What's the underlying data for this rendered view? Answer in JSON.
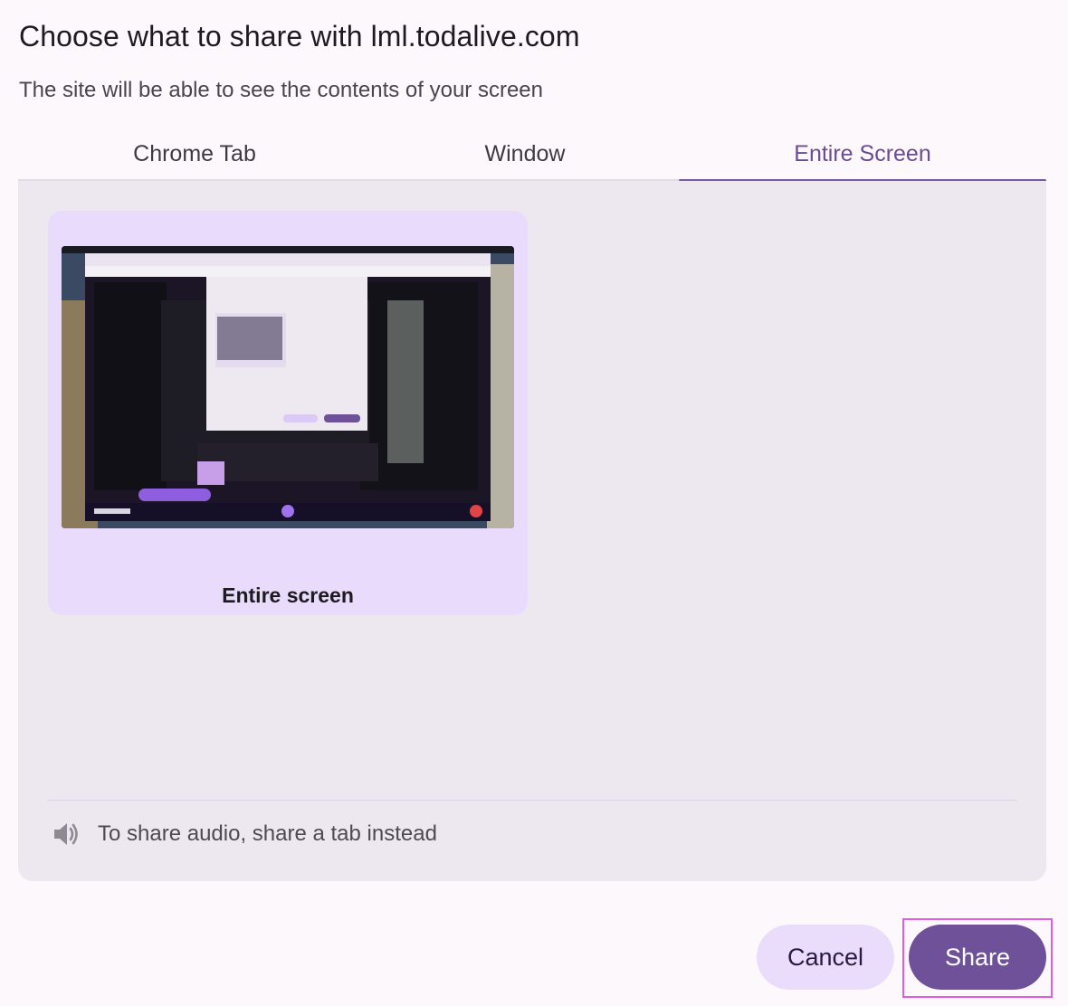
{
  "dialog": {
    "title": "Choose what to share with lml.todalive.com",
    "subtitle": "The site will be able to see the contents of your screen"
  },
  "tabs": [
    {
      "label": "Chrome Tab",
      "selected": false
    },
    {
      "label": "Window",
      "selected": false
    },
    {
      "label": "Entire Screen",
      "selected": true
    }
  ],
  "sources": [
    {
      "label": "Entire screen",
      "selected": true
    }
  ],
  "audio": {
    "icon": "speaker-icon",
    "text": "To share audio, share a tab instead"
  },
  "buttons": {
    "cancel": "Cancel",
    "share": "Share"
  },
  "colors": {
    "accent": "#6e5199",
    "selected_card": "#e8dbfb",
    "panel": "#ede7f0",
    "highlight_outline": "#e05ce2"
  }
}
